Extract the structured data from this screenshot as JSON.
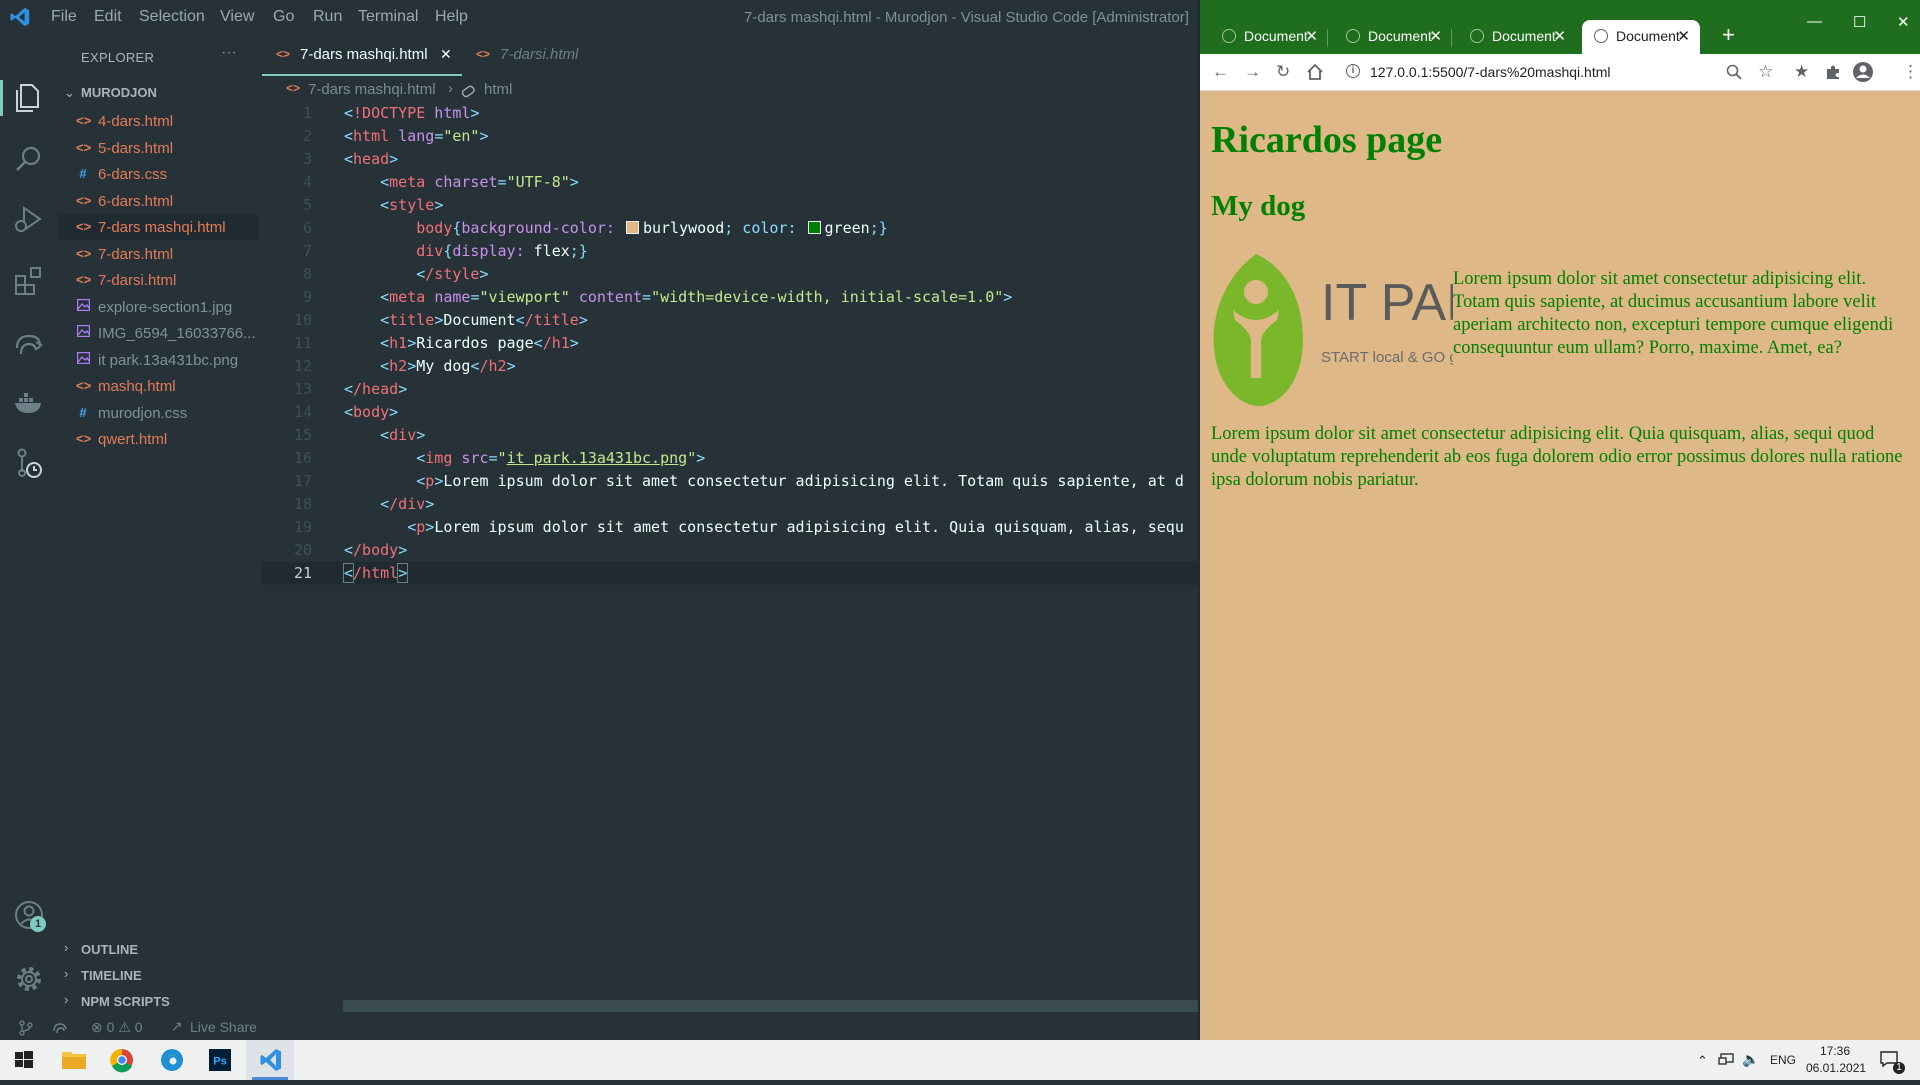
{
  "vscode": {
    "window_title": "7-dars mashqi.html - Murodjon - Visual Studio Code [Administrator]",
    "menu": [
      "File",
      "Edit",
      "Selection",
      "View",
      "Go",
      "Run",
      "Terminal",
      "Help"
    ],
    "explorer": {
      "label": "EXPLORER",
      "more": "···",
      "folder": "MURODJON",
      "files": [
        {
          "name": "4-dars.html",
          "icon": "<>",
          "color": "#e37b58",
          "text_color": "#e37b58"
        },
        {
          "name": "5-dars.html",
          "icon": "<>",
          "color": "#e37b58",
          "text_color": "#e37b58"
        },
        {
          "name": "6-dars.css",
          "icon": "#",
          "color": "#42a5f5",
          "text_color": "#e37b58"
        },
        {
          "name": "6-dars.html",
          "icon": "<>",
          "color": "#e37b58",
          "text_color": "#e37b58"
        },
        {
          "name": "7-dars mashqi.html",
          "icon": "<>",
          "color": "#e37b58",
          "text_color": "#e37b58"
        },
        {
          "name": "7-dars.html",
          "icon": "<>",
          "color": "#e37b58",
          "text_color": "#e37b58"
        },
        {
          "name": "7-darsi.html",
          "icon": "<>",
          "color": "#e37b58",
          "text_color": "#e37b58"
        },
        {
          "name": "explore-section1.jpg",
          "icon": "img",
          "color": "#ab7df8",
          "text_color": "#7f9199"
        },
        {
          "name": "IMG_6594_16033766...",
          "icon": "img",
          "color": "#ab7df8",
          "text_color": "#7f9199"
        },
        {
          "name": "it park.13a431bc.png",
          "icon": "img",
          "color": "#ab7df8",
          "text_color": "#7f9199"
        },
        {
          "name": "mashq.html",
          "icon": "<>",
          "color": "#e37b58",
          "text_color": "#e37b58"
        },
        {
          "name": "murodjon.css",
          "icon": "#",
          "color": "#42a5f5",
          "text_color": "#7f9199"
        },
        {
          "name": "qwert.html",
          "icon": "<>",
          "color": "#e37b58",
          "text_color": "#e37b58"
        }
      ],
      "sections": [
        "OUTLINE",
        "TIMELINE",
        "NPM SCRIPTS"
      ]
    },
    "tabs": [
      {
        "label": "7-dars mashqi.html",
        "close": "✕"
      },
      {
        "label": "7-darsi.html"
      }
    ],
    "breadcrumb": {
      "file": "7-dars mashqi.html",
      "sep": "›",
      "symbol": "html"
    },
    "code": {
      "line_numbers": [
        "1",
        "2",
        "3",
        "4",
        "5",
        "6",
        "7",
        "8",
        "9",
        "10",
        "11",
        "12",
        "13",
        "14",
        "15",
        "16",
        "17",
        "18",
        "19",
        "20",
        "21"
      ],
      "l1": {
        "open": "<",
        "tag": "!DOCTYPE",
        "rest": " html",
        "close": ">"
      },
      "l2": {
        "tag": "html",
        "attr": "lang",
        "val": "\"en\""
      },
      "l3": {
        "tag": "head"
      },
      "l4": {
        "tag": "meta",
        "attr": "charset",
        "val": "\"UTF-8\""
      },
      "l5": {
        "tag": "style"
      },
      "l6": {
        "sel": "body",
        "prop1": "background-color: ",
        "val1": "burlywood",
        "prop2": "; color: ",
        "val2": "green",
        "end": ";}",
        "swatch1": "#deb887",
        "swatch2": "#008000"
      },
      "l7": {
        "sel": "div",
        "prop": "display: ",
        "val": "flex",
        "end": ";}"
      },
      "l8": {
        "tag": "/style"
      },
      "l9": {
        "tag": "meta",
        "attr1": "name",
        "val1": "\"viewport\"",
        "attr2": "content",
        "val2": "\"width=device-width, initial-scale=1.0\""
      },
      "l10": {
        "tag": "title",
        "text": "Document",
        "ctag": "/title"
      },
      "l11": {
        "tag": "h1",
        "text": "Ricardos page",
        "ctag": "/h1"
      },
      "l12": {
        "tag": "h2",
        "text": "My dog",
        "ctag": "/h2"
      },
      "l13": {
        "tag": "/head"
      },
      "l14": {
        "tag": "body"
      },
      "l15": {
        "tag": "div"
      },
      "l16": {
        "tag": "img",
        "attr": "src",
        "q": "\"",
        "link": "it park.13a431bc.png"
      },
      "l17": {
        "tag": "p",
        "text": "Lorem ipsum dolor sit amet consectetur adipisicing elit. Totam quis sapiente, at d"
      },
      "l18": {
        "tag": "/div"
      },
      "l19": {
        "tag": "p",
        "text": "Lorem ipsum dolor sit amet consectetur adipisicing elit. Quia quisquam, alias, sequ"
      },
      "l20": {
        "tag": "/body"
      },
      "l21": {
        "tag": "/html"
      }
    },
    "status": {
      "problems": "⊗ 0 ⚠ 0",
      "live_share": "Live Share"
    },
    "account_badge": "1"
  },
  "chrome": {
    "tabs": [
      {
        "title": "Document",
        "close": "✕"
      },
      {
        "title": "Document",
        "close": "✕"
      },
      {
        "title": "Document",
        "close": "✕"
      },
      {
        "title": "Document",
        "close": "✕"
      }
    ],
    "new_tab": "+",
    "window_buttons": [
      "—",
      "☐",
      "✕"
    ],
    "url": "127.0.0.1:5500/7-dars%20mashqi.html",
    "info": "i",
    "page": {
      "h1": "Ricardos page",
      "h2": "My dog",
      "logo_title": "IT PARK",
      "logo_tagline": "START local & GO global",
      "p1": "Lorem ipsum dolor sit amet consectetur adipisicing elit. Totam quis sapiente, at ducimus accusantium labore velit aperiam architecto non, excepturi tempore cumque eligendi consequuntur eum ullam? Porro, maxime. Amet, ea?",
      "p2": "Lorem ipsum dolor sit amet consectetur adipisicing elit. Quia quisquam, alias, sequi quod unde voluptatum reprehenderit ab eos fuga dolorem odio error possimus dolores nulla ratione ipsa dolorum nobis pariatur."
    }
  },
  "taskbar": {
    "lang": "ENG",
    "time": "17:36",
    "date": "06.01.2021",
    "notif_count": "1"
  }
}
